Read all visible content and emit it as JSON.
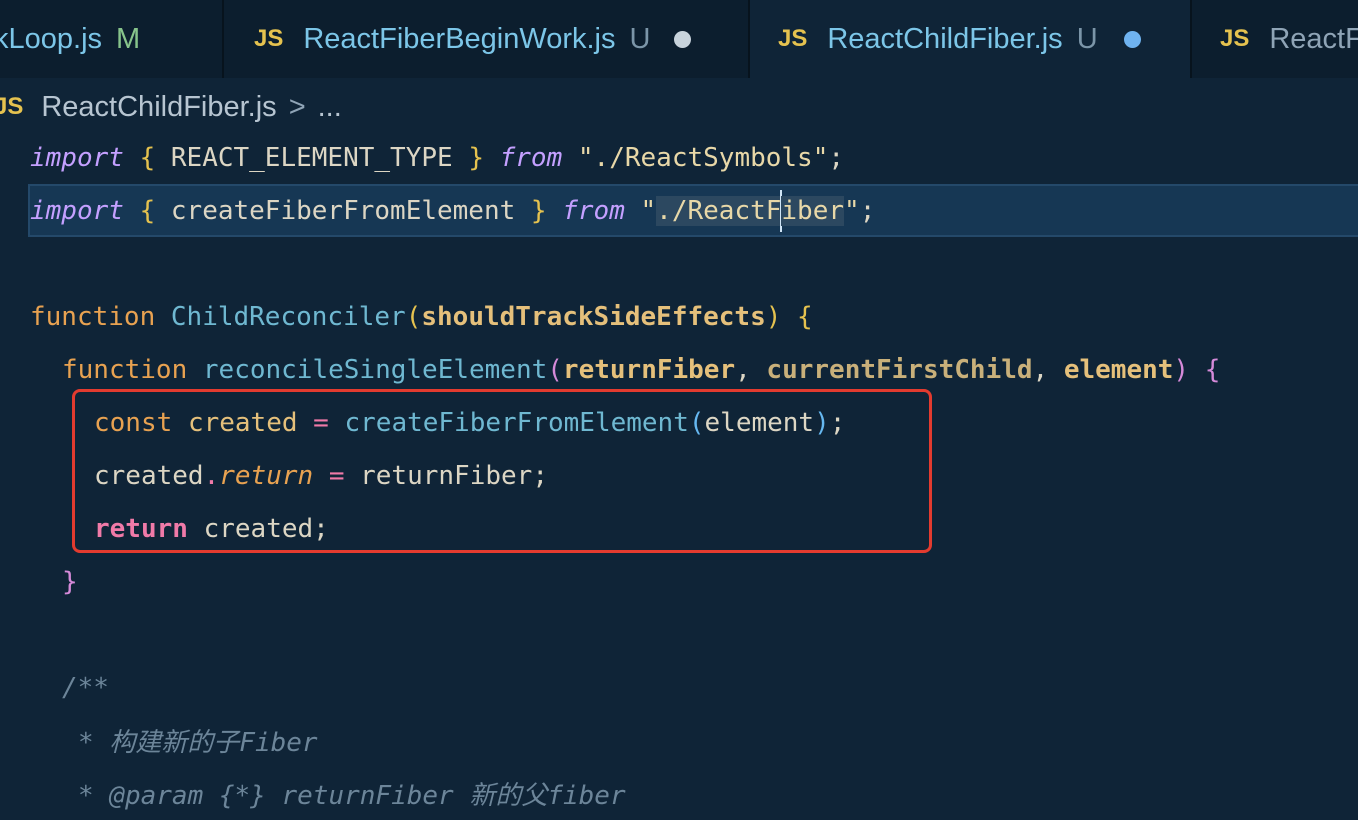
{
  "tabs": [
    {
      "badge": "",
      "name": "kLoop.js",
      "flag": "M",
      "active": false
    },
    {
      "badge": "JS",
      "name": "ReactFiberBeginWork.js",
      "flag": "U",
      "dot_color": "#c8d3dc",
      "active": false
    },
    {
      "badge": "JS",
      "name": "ReactChildFiber.js",
      "flag": "U",
      "dot_color": "#6fb3f0",
      "active": true
    },
    {
      "badge": "JS",
      "name": "ReactFi",
      "active": false
    }
  ],
  "breadcrumb": {
    "badge": "JS",
    "file": "ReactChildFiber.js",
    "separator": ">",
    "more": "..."
  },
  "code": {
    "line1": {
      "kw": "import",
      "open": "{",
      "name": "REACT_ELEMENT_TYPE",
      "close": "}",
      "from": "from",
      "str": "\"./ReactSymbols\"",
      "semi": ";"
    },
    "line2": {
      "kw": "import",
      "open": "{",
      "name": "createFiberFromElement",
      "close": "}",
      "from": "from",
      "str_pre": "\"",
      "str_sel_a": "./ReactF",
      "str_sel_b": "iber",
      "str_post": "\"",
      "semi": ";"
    },
    "line4": {
      "kw": "function",
      "fn": "ChildReconciler",
      "open": "(",
      "param": "shouldTrackSideEffects",
      "close": ")",
      "brace": "{"
    },
    "line5": {
      "kw": "function",
      "fn": "reconcileSingleElement",
      "open": "(",
      "p1": "returnFiber",
      "comma1": ",",
      "p2": "currentFirstChild",
      "comma2": ",",
      "p3": "element",
      "close": ")",
      "brace": "{"
    },
    "line6": {
      "kw": "const",
      "var": "created",
      "op": "=",
      "fn": "createFiberFromElement",
      "open": "(",
      "arg": "element",
      "close": ")",
      "semi": ";"
    },
    "line7": {
      "obj": "created",
      "dot": ".",
      "prop": "return",
      "op": "=",
      "val": "returnFiber",
      "semi": ";"
    },
    "line8": {
      "kw": "return",
      "val": "created",
      "semi": ";"
    },
    "line9": {
      "brace": "}"
    },
    "line11": {
      "text": "/**"
    },
    "line12": {
      "text": "* 构建新的子Fiber"
    },
    "line13": {
      "text": "* @param {*} returnFiber 新的父fiber"
    }
  },
  "colors": {
    "background": "#0f2437",
    "annotation_box": "#e33b2f"
  }
}
